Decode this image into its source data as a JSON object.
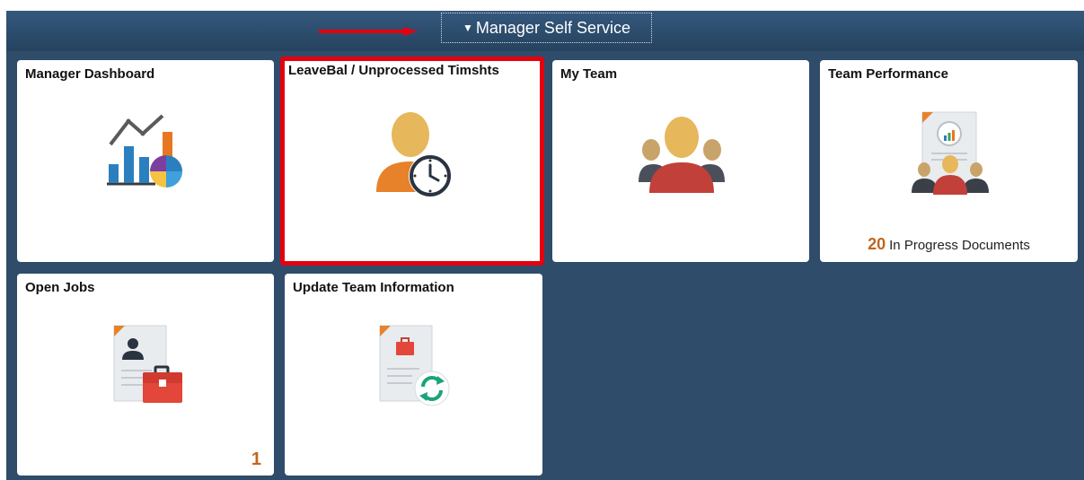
{
  "header": {
    "collection_title": "Manager Self Service",
    "pointer_arrow_color": "#e4000f"
  },
  "tiles": [
    {
      "title": "Manager Dashboard",
      "icon": "dashboard-chart-icon"
    },
    {
      "title": "LeaveBal / Unprocessed Timshts",
      "icon": "person-clock-icon",
      "highlighted": true
    },
    {
      "title": "My Team",
      "icon": "team-people-icon"
    },
    {
      "title": "Team Performance",
      "icon": "performance-document-icon",
      "count": "20",
      "count_label": "In Progress Documents"
    },
    {
      "title": "Open Jobs",
      "icon": "job-document-briefcase-icon",
      "badge": "1"
    },
    {
      "title": "Update Team Information",
      "icon": "update-document-refresh-icon"
    }
  ],
  "colors": {
    "background": "#2f4c6a",
    "tile": "#ffffff",
    "highlight_border": "#e4000f",
    "count_accent": "#c0661f"
  }
}
